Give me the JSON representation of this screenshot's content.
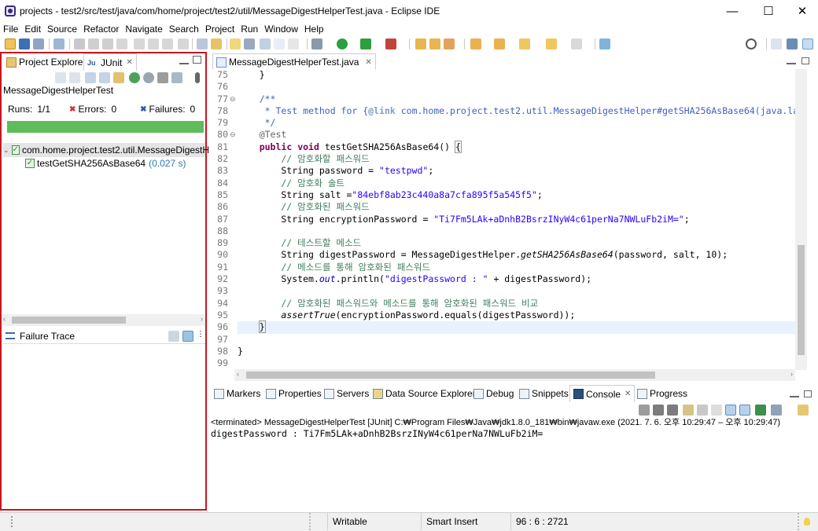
{
  "window": {
    "title": "projects - test2/src/test/java/com/home/project/test2/util/MessageDigestHelperTest.java - Eclipse IDE",
    "min": "—",
    "max": "☐",
    "close": "✕"
  },
  "menu": [
    "File",
    "Edit",
    "Source",
    "Refactor",
    "Navigate",
    "Search",
    "Project",
    "Run",
    "Window",
    "Help"
  ],
  "left_panel": {
    "tabs": [
      {
        "label": "Project Explorer"
      },
      {
        "label": "JUnit"
      }
    ],
    "test_class": "MessageDigestHelperTest",
    "runs_label": "Runs:",
    "runs_value": "1/1",
    "errors_label": "Errors:",
    "errors_value": "0",
    "failures_label": "Failures:",
    "failures_value": "0",
    "tree": [
      {
        "label": "com.home.project.test2.util.MessageDigestHelp"
      },
      {
        "label": "testGetSHA256AsBase64",
        "time": "(0.027 s)"
      }
    ],
    "failure_trace": "Failure Trace",
    "progress": 1.0,
    "bar_color": "#5ebc5b"
  },
  "editor": {
    "tab_label": "MessageDigestHelperTest.java",
    "line_numbers": [
      "75",
      "76",
      "77",
      "78",
      "79",
      "80",
      "81",
      "82",
      "83",
      "84",
      "85",
      "86",
      "87",
      "88",
      "89",
      "90",
      "91",
      "92",
      "93",
      "94",
      "95",
      "96",
      "97",
      "98",
      "99"
    ],
    "fold_markers": {
      "77": "⊖",
      "80": "⊖"
    },
    "lines": [
      "    }",
      "",
      "    /**",
      "     * Test method for {@link com.home.project.test2.util.MessageDigestHelper#getSHA256AsBase64(java.lang.",
      "     */",
      "    @Test",
      "    public void testGetSHA256AsBase64() {",
      "        // 암호화할 패스워드",
      "        String password = \"testpwd\";",
      "        // 암호화 솔트",
      "        String salt =\"84ebf8ab23c440a8a7cfa895f5a545f5\";",
      "        // 암호화된 패스워드",
      "        String encryptionPassword = \"Ti7Fm5LAk+aDnhB2BsrzINyW4c61perNa7NWLuFb2iM=\";",
      "",
      "        // 테스트할 메소드",
      "        String digestPassword = MessageDigestHelper.getSHA256AsBase64(password, salt, 10);",
      "        // 메소드를 통해 암호화된 패스워드",
      "        System.out.println(\"digestPassword : \" + digestPassword);",
      "",
      "        // 암호화된 패스워드와 메소드를 통해 암호화된 패스워드 비교",
      "        assertTrue(encryptionPassword.equals(digestPassword));",
      "    }",
      "",
      "}",
      ""
    ]
  },
  "bottom_panel": {
    "tabs": [
      "Markers",
      "Properties",
      "Servers",
      "Data Source Explorer",
      "Debug",
      "Snippets",
      "Console",
      "Progress"
    ],
    "console_header": "<terminated> MessageDigestHelperTest [JUnit] C:₩Program Files₩Java₩jdk1.8.0_181₩bin₩javaw.exe  (2021. 7. 6. 오후 10:29:47 – 오후 10:29:47)",
    "console_output": "digestPassword : Ti7Fm5LAk+aDnhB2BsrzINyW4c61perNa7NWLuFb2iM="
  },
  "status_bar": {
    "writable": "Writable",
    "insert_mode": "Smart Insert",
    "position": "96 : 6 : 2721"
  },
  "colors": {
    "highlight_frame": "#c8161d",
    "keyword": "#7f0055",
    "comment": "#3f7f5f",
    "string": "#2a00ff"
  }
}
